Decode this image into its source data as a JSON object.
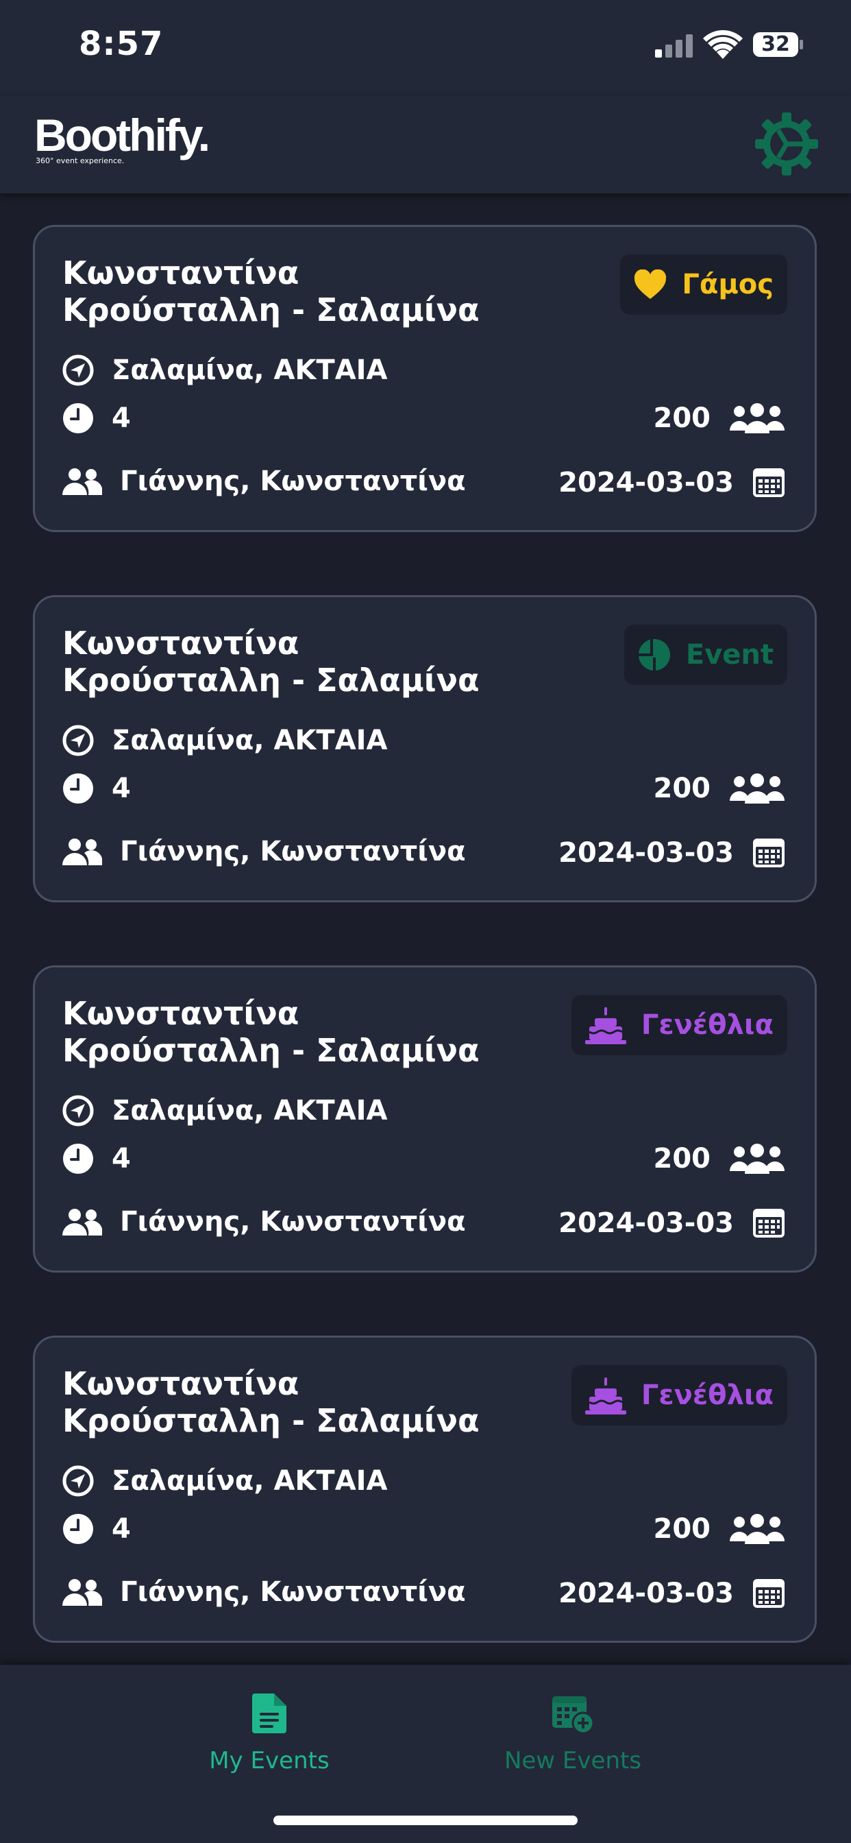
{
  "status_bar": {
    "time": "8:57",
    "battery": "32"
  },
  "header": {
    "logo_text": "Boothify.",
    "logo_tagline": "360° event experience."
  },
  "events": [
    {
      "title": "Κωνσταντίνα Κρούσταλλη - Σαλαμίνα",
      "badge_label": "Γάμος",
      "badge_icon": "heart-icon",
      "badge_color": "#f6c21c",
      "location": "Σαλαμίνα, ΑΚΤΑΙΑ",
      "duration": "4",
      "guests": "200",
      "hosts": "Γιάννης, Κωνσταντίνα",
      "date": "2024-03-03"
    },
    {
      "title": "Κωνσταντίνα Κρούσταλλη - Σαλαμίνα",
      "badge_label": "Event",
      "badge_icon": "globe-icon",
      "badge_color": "#0f6e50",
      "location": "Σαλαμίνα, ΑΚΤΑΙΑ",
      "duration": "4",
      "guests": "200",
      "hosts": "Γιάννης, Κωνσταντίνα",
      "date": "2024-03-03"
    },
    {
      "title": "Κωνσταντίνα Κρούσταλλη - Σαλαμίνα",
      "badge_label": "Γενέθλια",
      "badge_icon": "cake-icon",
      "badge_color": "#a550e0",
      "location": "Σαλαμίνα, ΑΚΤΑΙΑ",
      "duration": "4",
      "guests": "200",
      "hosts": "Γιάννης, Κωνσταντίνα",
      "date": "2024-03-03"
    },
    {
      "title": "Κωνσταντίνα Κρούσταλλη - Σαλαμίνα",
      "badge_label": "Γενέθλια",
      "badge_icon": "cake-icon",
      "badge_color": "#a550e0",
      "location": "Σαλαμίνα, ΑΚΤΑΙΑ",
      "duration": "4",
      "guests": "200",
      "hosts": "Γιάννης, Κωνσταντίνα",
      "date": "2024-03-03"
    }
  ],
  "tabs": [
    {
      "label": "My Events",
      "icon": "document-icon",
      "active": true
    },
    {
      "label": "New Events",
      "icon": "calendar-add-icon",
      "active": false
    }
  ],
  "colors": {
    "accent": "#1fb88c",
    "inactive_tab": "#157a5d",
    "background": "#1b1e2a",
    "surface": "#222838",
    "card": "#232939"
  }
}
